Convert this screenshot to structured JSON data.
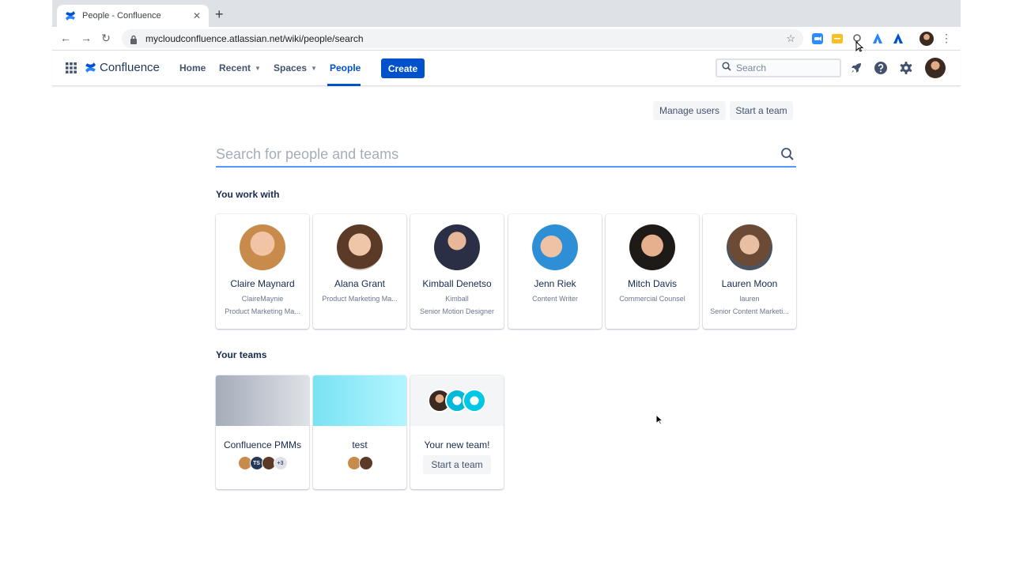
{
  "browser": {
    "tab_title": "People - Confluence",
    "url": "mycloudconfluence.atlassian.net/wiki/people/search"
  },
  "nav": {
    "app_name": "Confluence",
    "items": [
      {
        "label": "Home"
      },
      {
        "label": "Recent"
      },
      {
        "label": "Spaces"
      },
      {
        "label": "People"
      }
    ],
    "create_label": "Create",
    "search_placeholder": "Search"
  },
  "actions": {
    "manage_users": "Manage users",
    "start_team": "Start a team"
  },
  "people_search": {
    "placeholder": "Search for people and teams"
  },
  "sections": {
    "you_work_with": "You work with",
    "your_teams": "Your teams"
  },
  "people": [
    {
      "name": "Claire Maynard",
      "username": "ClaireMaynie",
      "title": "Product Marketing Ma..."
    },
    {
      "name": "Alana Grant",
      "username": "",
      "title": "Product Marketing Ma..."
    },
    {
      "name": "Kimball Denetso",
      "username": "Kimball",
      "title": "Senior Motion Designer"
    },
    {
      "name": "Jenn Riek",
      "username": "",
      "title": "Content Writer"
    },
    {
      "name": "Mitch Davis",
      "username": "",
      "title": "Commercial Counsel"
    },
    {
      "name": "Lauren Moon",
      "username": "lauren",
      "title": "Senior Content Marketi..."
    }
  ],
  "teams": [
    {
      "name": "Confluence PMMs",
      "member_initials": "TS",
      "extra_count": "+3"
    },
    {
      "name": "test"
    },
    {
      "name": "Your new team!",
      "button_label": "Start a team"
    }
  ],
  "colors": {
    "brand_blue": "#0052cc",
    "focus_blue": "#4c9aff",
    "team_gray_gradient": "#a5adba",
    "team_teal_gradient": "#79e2f2"
  }
}
